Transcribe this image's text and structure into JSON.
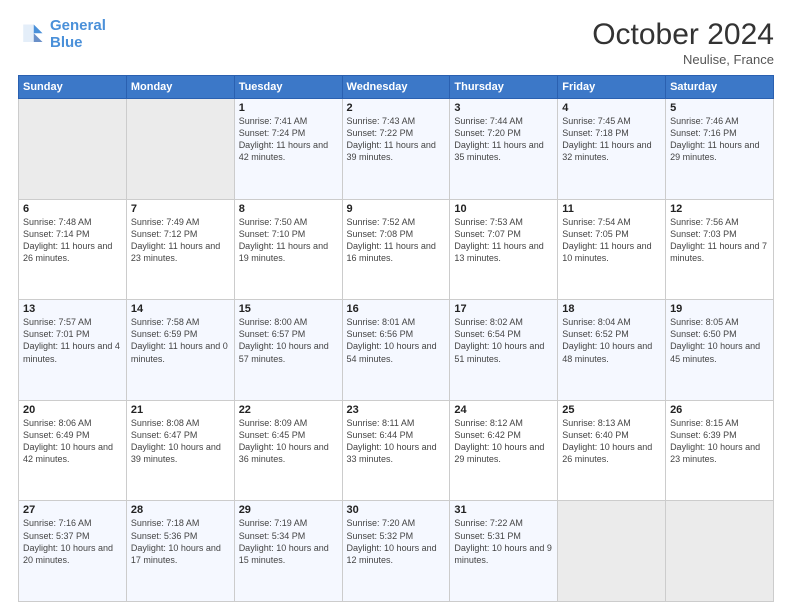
{
  "header": {
    "logo_line1": "General",
    "logo_line2": "Blue",
    "month": "October 2024",
    "location": "Neulise, France"
  },
  "days_of_week": [
    "Sunday",
    "Monday",
    "Tuesday",
    "Wednesday",
    "Thursday",
    "Friday",
    "Saturday"
  ],
  "weeks": [
    [
      {
        "day": "",
        "info": ""
      },
      {
        "day": "",
        "info": ""
      },
      {
        "day": "1",
        "info": "Sunrise: 7:41 AM\nSunset: 7:24 PM\nDaylight: 11 hours and 42 minutes."
      },
      {
        "day": "2",
        "info": "Sunrise: 7:43 AM\nSunset: 7:22 PM\nDaylight: 11 hours and 39 minutes."
      },
      {
        "day": "3",
        "info": "Sunrise: 7:44 AM\nSunset: 7:20 PM\nDaylight: 11 hours and 35 minutes."
      },
      {
        "day": "4",
        "info": "Sunrise: 7:45 AM\nSunset: 7:18 PM\nDaylight: 11 hours and 32 minutes."
      },
      {
        "day": "5",
        "info": "Sunrise: 7:46 AM\nSunset: 7:16 PM\nDaylight: 11 hours and 29 minutes."
      }
    ],
    [
      {
        "day": "6",
        "info": "Sunrise: 7:48 AM\nSunset: 7:14 PM\nDaylight: 11 hours and 26 minutes."
      },
      {
        "day": "7",
        "info": "Sunrise: 7:49 AM\nSunset: 7:12 PM\nDaylight: 11 hours and 23 minutes."
      },
      {
        "day": "8",
        "info": "Sunrise: 7:50 AM\nSunset: 7:10 PM\nDaylight: 11 hours and 19 minutes."
      },
      {
        "day": "9",
        "info": "Sunrise: 7:52 AM\nSunset: 7:08 PM\nDaylight: 11 hours and 16 minutes."
      },
      {
        "day": "10",
        "info": "Sunrise: 7:53 AM\nSunset: 7:07 PM\nDaylight: 11 hours and 13 minutes."
      },
      {
        "day": "11",
        "info": "Sunrise: 7:54 AM\nSunset: 7:05 PM\nDaylight: 11 hours and 10 minutes."
      },
      {
        "day": "12",
        "info": "Sunrise: 7:56 AM\nSunset: 7:03 PM\nDaylight: 11 hours and 7 minutes."
      }
    ],
    [
      {
        "day": "13",
        "info": "Sunrise: 7:57 AM\nSunset: 7:01 PM\nDaylight: 11 hours and 4 minutes."
      },
      {
        "day": "14",
        "info": "Sunrise: 7:58 AM\nSunset: 6:59 PM\nDaylight: 11 hours and 0 minutes."
      },
      {
        "day": "15",
        "info": "Sunrise: 8:00 AM\nSunset: 6:57 PM\nDaylight: 10 hours and 57 minutes."
      },
      {
        "day": "16",
        "info": "Sunrise: 8:01 AM\nSunset: 6:56 PM\nDaylight: 10 hours and 54 minutes."
      },
      {
        "day": "17",
        "info": "Sunrise: 8:02 AM\nSunset: 6:54 PM\nDaylight: 10 hours and 51 minutes."
      },
      {
        "day": "18",
        "info": "Sunrise: 8:04 AM\nSunset: 6:52 PM\nDaylight: 10 hours and 48 minutes."
      },
      {
        "day": "19",
        "info": "Sunrise: 8:05 AM\nSunset: 6:50 PM\nDaylight: 10 hours and 45 minutes."
      }
    ],
    [
      {
        "day": "20",
        "info": "Sunrise: 8:06 AM\nSunset: 6:49 PM\nDaylight: 10 hours and 42 minutes."
      },
      {
        "day": "21",
        "info": "Sunrise: 8:08 AM\nSunset: 6:47 PM\nDaylight: 10 hours and 39 minutes."
      },
      {
        "day": "22",
        "info": "Sunrise: 8:09 AM\nSunset: 6:45 PM\nDaylight: 10 hours and 36 minutes."
      },
      {
        "day": "23",
        "info": "Sunrise: 8:11 AM\nSunset: 6:44 PM\nDaylight: 10 hours and 33 minutes."
      },
      {
        "day": "24",
        "info": "Sunrise: 8:12 AM\nSunset: 6:42 PM\nDaylight: 10 hours and 29 minutes."
      },
      {
        "day": "25",
        "info": "Sunrise: 8:13 AM\nSunset: 6:40 PM\nDaylight: 10 hours and 26 minutes."
      },
      {
        "day": "26",
        "info": "Sunrise: 8:15 AM\nSunset: 6:39 PM\nDaylight: 10 hours and 23 minutes."
      }
    ],
    [
      {
        "day": "27",
        "info": "Sunrise: 7:16 AM\nSunset: 5:37 PM\nDaylight: 10 hours and 20 minutes."
      },
      {
        "day": "28",
        "info": "Sunrise: 7:18 AM\nSunset: 5:36 PM\nDaylight: 10 hours and 17 minutes."
      },
      {
        "day": "29",
        "info": "Sunrise: 7:19 AM\nSunset: 5:34 PM\nDaylight: 10 hours and 15 minutes."
      },
      {
        "day": "30",
        "info": "Sunrise: 7:20 AM\nSunset: 5:32 PM\nDaylight: 10 hours and 12 minutes."
      },
      {
        "day": "31",
        "info": "Sunrise: 7:22 AM\nSunset: 5:31 PM\nDaylight: 10 hours and 9 minutes."
      },
      {
        "day": "",
        "info": ""
      },
      {
        "day": "",
        "info": ""
      }
    ]
  ]
}
